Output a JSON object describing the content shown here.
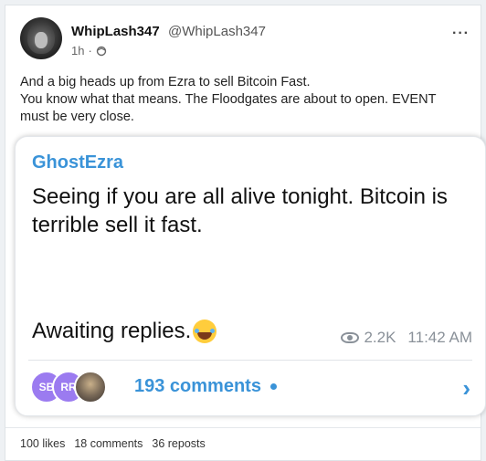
{
  "author": {
    "name": "WhipLash347",
    "handle": "@WhipLash347",
    "time": "1h",
    "separator": "·"
  },
  "more_label": "···",
  "body_lines": [
    "And a big heads up from Ezra to sell Bitcoin Fast.",
    "You know what that means. The Floodgates are about to open. EVENT must be very close."
  ],
  "embed": {
    "channel": "GhostEzra",
    "message": "Seeing if you are all alive tonight. Bitcoin is terrible sell it fast.",
    "message2": "Awaiting replies.",
    "emoji": "joy-emoji",
    "views": "2.2K",
    "time": "11:42 AM",
    "avatars": [
      "SB",
      "RR"
    ],
    "comments": "193 comments",
    "chevron": "›",
    "accent_color": "#3a93d8"
  },
  "stats": {
    "likes": "100 likes",
    "comments": "18 comments",
    "reposts": "36 reposts"
  }
}
